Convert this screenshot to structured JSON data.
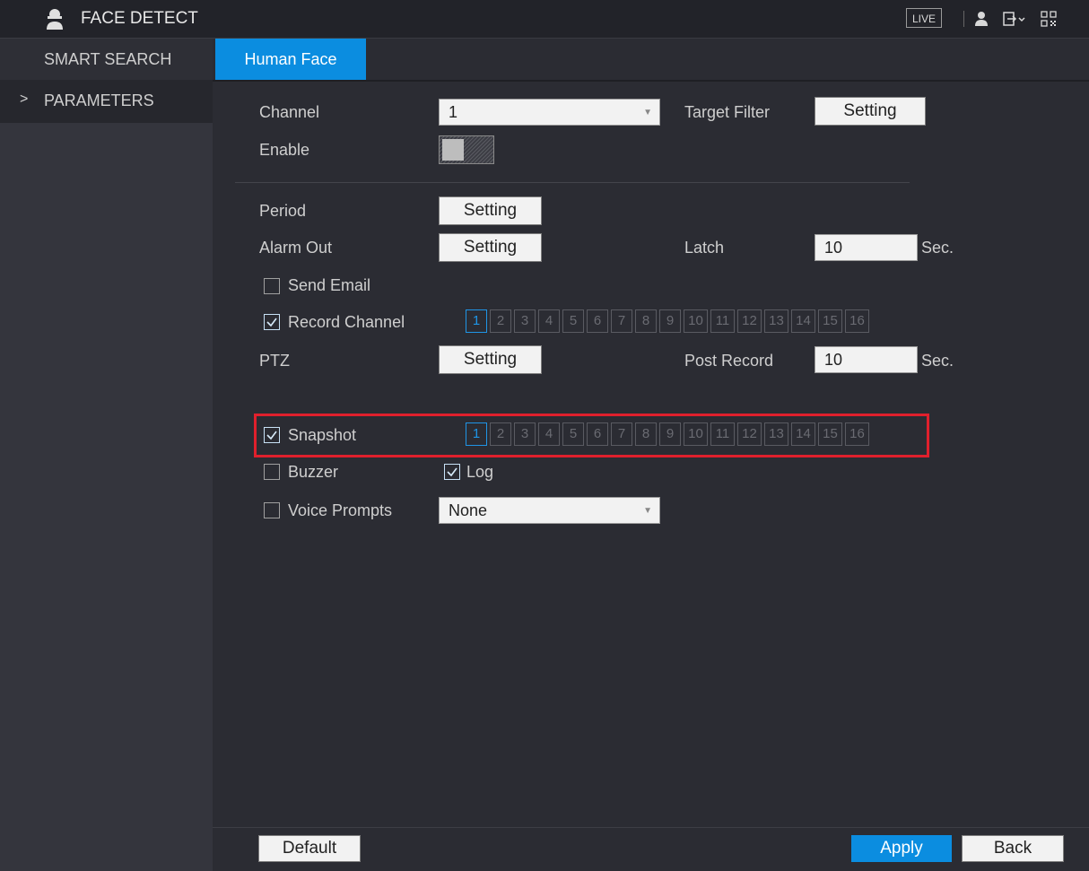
{
  "header": {
    "title": "FACE DETECT",
    "live_label": "LIVE",
    "icons": [
      "face-detect-icon",
      "user-icon",
      "logout-icon",
      "qr-code-icon"
    ]
  },
  "sidebar": {
    "items": [
      {
        "label": "SMART SEARCH"
      },
      {
        "label": "PARAMETERS",
        "chevron": ">"
      }
    ]
  },
  "tabs": [
    {
      "label": "Human Face",
      "active": true
    }
  ],
  "form": {
    "channel": {
      "label": "Channel",
      "value": "1"
    },
    "target_filter": {
      "label": "Target Filter",
      "button": "Setting"
    },
    "enable": {
      "label": "Enable",
      "on": false
    },
    "period": {
      "label": "Period",
      "button": "Setting"
    },
    "alarm_out": {
      "label": "Alarm Out",
      "button": "Setting"
    },
    "latch": {
      "label": "Latch",
      "value": "10",
      "unit": "Sec."
    },
    "send_email": {
      "label": "Send Email",
      "checked": false
    },
    "record_channel": {
      "label": "Record Channel",
      "checked": true,
      "selected": [
        "1"
      ]
    },
    "ptz": {
      "label": "PTZ",
      "button": "Setting"
    },
    "post_record": {
      "label": "Post Record",
      "value": "10",
      "unit": "Sec."
    },
    "snapshot": {
      "label": "Snapshot",
      "checked": true,
      "selected": [
        "1"
      ]
    },
    "buzzer": {
      "label": "Buzzer",
      "checked": false
    },
    "log": {
      "label": "Log",
      "checked": true
    },
    "voice_prompts": {
      "label": "Voice Prompts",
      "checked": false,
      "value": "None"
    }
  },
  "channels": [
    "1",
    "2",
    "3",
    "4",
    "5",
    "6",
    "7",
    "8",
    "9",
    "10",
    "11",
    "12",
    "13",
    "14",
    "15",
    "16"
  ],
  "footer": {
    "default": "Default",
    "apply": "Apply",
    "back": "Back"
  },
  "colors": {
    "accent": "#0b8de0",
    "highlight_border": "#e0202c",
    "background": "#2b2c33"
  }
}
